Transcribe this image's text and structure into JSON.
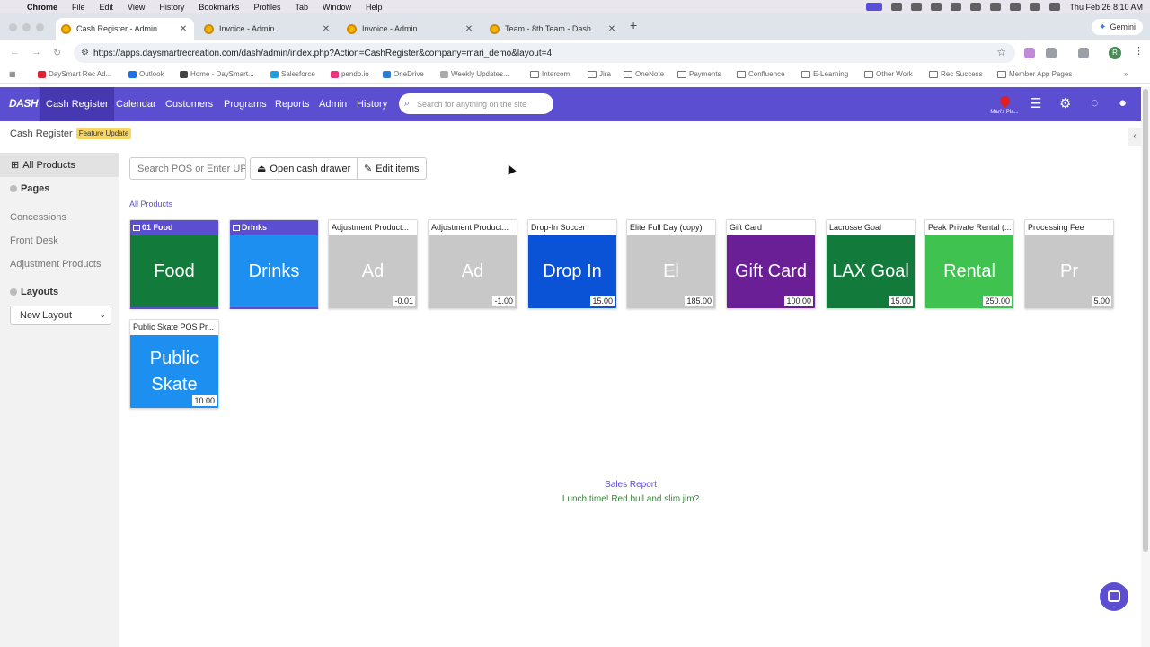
{
  "macmenu": {
    "app": "Chrome",
    "items": [
      "File",
      "Edit",
      "View",
      "History",
      "Bookmarks",
      "Profiles",
      "Tab",
      "Window",
      "Help"
    ],
    "datetime": "Thu Feb 26  8:10 AM"
  },
  "tabs": [
    {
      "label": "Cash Register - Admin"
    },
    {
      "label": "Invoice - Admin"
    },
    {
      "label": "Invoice - Admin"
    },
    {
      "label": "Team - 8th Team - Dash"
    }
  ],
  "gemini_label": "Gemini",
  "url": "https://apps.daysmartrecreation.com/dash/admin/index.php?Action=CashRegister&company=mari_demo&layout=4",
  "bookmarks": [
    "DaySmart Rec Ad...",
    "Outlook",
    "Home - DaySmart...",
    "Salesforce",
    "pendo.io",
    "OneDrive",
    "Weekly Updates...",
    "Intercom",
    "Jira",
    "OneNote",
    "Payments",
    "Confluence",
    "E-Learning",
    "Other Work",
    "Rec Success",
    "Member App Pages"
  ],
  "appnav": {
    "logo": "DASH",
    "items": [
      "Cash Register",
      "Calendar",
      "Customers",
      "Programs",
      "Reports",
      "Admin",
      "History"
    ],
    "search_placeholder": "Search for anything on the site",
    "location_label": "Mari's Pla..."
  },
  "header": {
    "title": "Cash Register",
    "badge": "Feature Update"
  },
  "sidebar": {
    "active_item": "All Products",
    "pages_heading": "Pages",
    "pages": [
      "Concessions",
      "Front Desk",
      "Adjustment Products"
    ],
    "layouts_heading": "Layouts",
    "layout_selected": "New Layout"
  },
  "toolbar": {
    "search_placeholder": "Search POS or Enter UPC",
    "open_drawer": "Open cash drawer",
    "edit_items": "Edit items"
  },
  "breadcrumb_link": "All Products",
  "tiles": [
    {
      "header": "01 Food",
      "body": "Food",
      "price": "",
      "color": "#127a3a",
      "group": true
    },
    {
      "header": "Drinks",
      "body": "Drinks",
      "price": "",
      "color": "#1c8ff0",
      "group": true
    },
    {
      "header": "Adjustment Product...",
      "body": "Ad",
      "price": "-0.01",
      "color": "#c8c8c8",
      "group": false
    },
    {
      "header": "Adjustment Product...",
      "body": "Ad",
      "price": "-1.00",
      "color": "#c8c8c8",
      "group": false
    },
    {
      "header": "Drop-In Soccer",
      "body": "Drop In",
      "price": "15.00",
      "color": "#0a52d6",
      "group": false
    },
    {
      "header": "Elite Full Day (copy)",
      "body": "El",
      "price": "185.00",
      "color": "#c8c8c8",
      "group": false
    },
    {
      "header": "Gift Card",
      "body": "Gift Card",
      "price": "100.00",
      "color": "#6a1f96",
      "group": false
    },
    {
      "header": "Lacrosse Goal",
      "body": "LAX Goal",
      "price": "15.00",
      "color": "#127a3a",
      "group": false
    },
    {
      "header": "Peak Private Rental (...",
      "body": "Rental",
      "price": "250.00",
      "color": "#3fc24f",
      "group": false
    },
    {
      "header": "Processing Fee",
      "body": "Pr",
      "price": "5.00",
      "color": "#c8c8c8",
      "group": false
    },
    {
      "header": "Public Skate POS Pr...",
      "body": "Public Skate",
      "price": "10.00",
      "color": "#1c8ff0",
      "group": false
    }
  ],
  "footer": {
    "sales_report": "Sales Report",
    "lunch": "Lunch time! Red bull and slim jim?"
  },
  "colors": {
    "brand": "#5b4ed0",
    "badge": "#f7d560"
  }
}
